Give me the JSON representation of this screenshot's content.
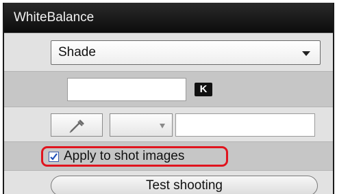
{
  "window": {
    "title": "WhiteBalance"
  },
  "white_balance": {
    "selected_preset": "Shade",
    "kelvin_value": "",
    "kelvin_unit_badge": "K"
  },
  "click_wb": {
    "eyedropper_icon": "eyedropper-icon",
    "selected_value": "",
    "value_field": ""
  },
  "apply_option": {
    "label": "Apply to shot images",
    "checked": true
  },
  "actions": {
    "test_shooting_label": "Test shooting"
  },
  "colors": {
    "header_bg": "#111111",
    "panel_bg": "#d9d9d9",
    "highlight_outline": "#e0141e",
    "checkmark": "#1f4fb8"
  }
}
